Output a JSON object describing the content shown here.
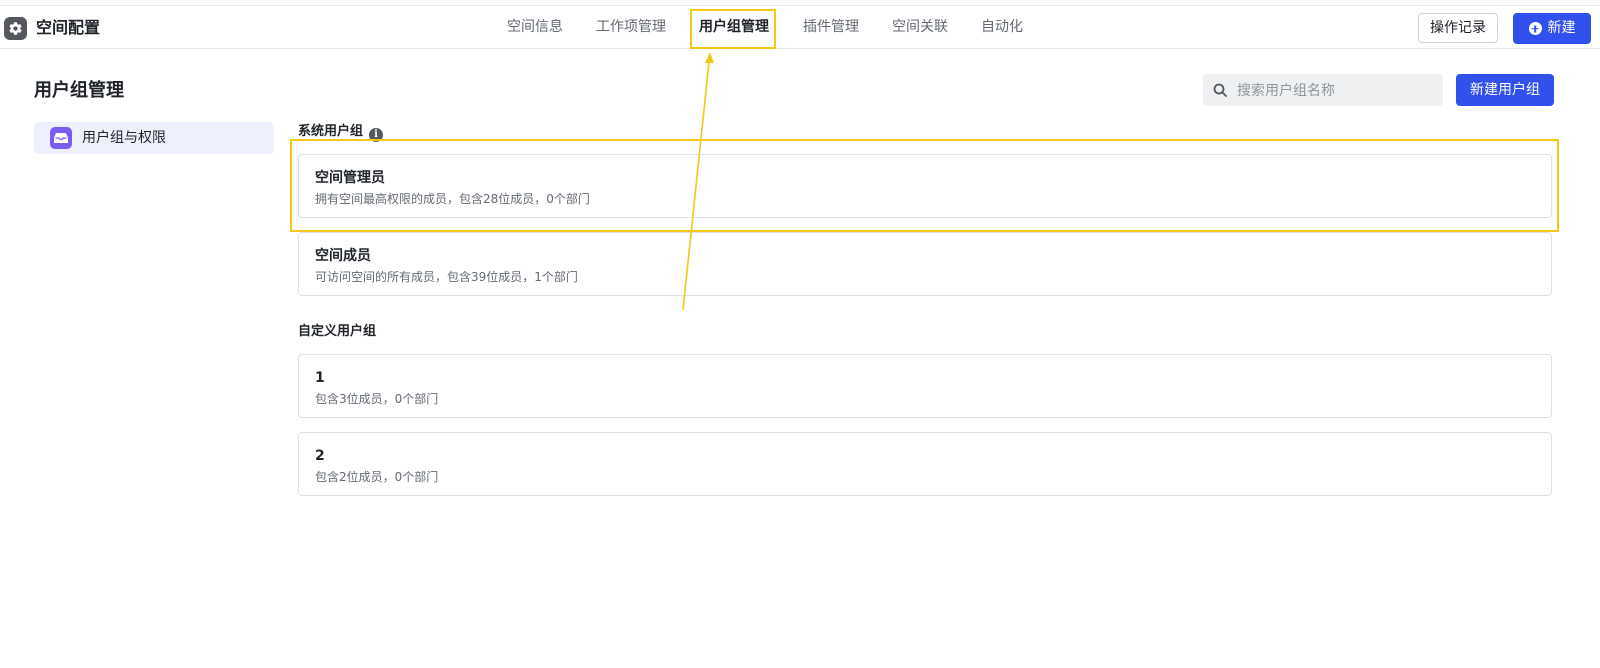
{
  "app": {
    "title": "空间配置",
    "icon": "gear-icon"
  },
  "tabs": [
    {
      "label": "空间信息"
    },
    {
      "label": "工作项管理"
    },
    {
      "label": "用户组管理",
      "active": true
    },
    {
      "label": "插件管理"
    },
    {
      "label": "空间关联"
    },
    {
      "label": "自动化"
    }
  ],
  "header_actions": {
    "history": "操作记录",
    "new": "新建"
  },
  "page": {
    "title": "用户组管理"
  },
  "sidebar": {
    "items": [
      {
        "label": "用户组与权限",
        "icon": "inbox-icon"
      }
    ]
  },
  "search": {
    "placeholder": "搜索用户组名称",
    "value": ""
  },
  "create_group_button": "新建用户组",
  "system_groups": {
    "label": "系统用户组",
    "items": [
      {
        "name": "空间管理员",
        "desc": "拥有空间最高权限的成员，包含28位成员，0个部门"
      },
      {
        "name": "空间成员",
        "desc": "可访问空间的所有成员，包含39位成员，1个部门"
      }
    ]
  },
  "custom_groups": {
    "label": "自定义用户组",
    "items": [
      {
        "name": "1",
        "desc": "包含3位成员，0个部门"
      },
      {
        "name": "2",
        "desc": "包含2位成员，0个部门"
      }
    ]
  },
  "colors": {
    "accent": "#3250eb",
    "highlight": "#f5c518",
    "sidebar_icon": "#7a5cf0"
  }
}
